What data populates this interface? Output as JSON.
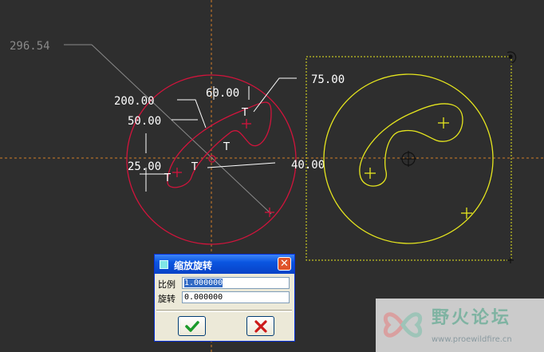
{
  "dimensions": {
    "d1": "296.54",
    "d2": "75.00",
    "d3": "200.00",
    "d4": "60.00",
    "d5": "50.00",
    "d6": "25.00",
    "d7": "40.00"
  },
  "tangent_mark": "T",
  "colors": {
    "background": "#2e2e2e",
    "sketch_red": "#d2143c",
    "sketch_yellow": "#e6e61e",
    "centerline": "#d27d28",
    "dimension_text": "#ffffff"
  },
  "dialog": {
    "title": "缩放旋转",
    "close_label": "✕",
    "scale_label": "比例",
    "scale_value": "1.000000",
    "rotate_label": "旋转",
    "rotate_value": "0.000000",
    "ok_icon": "check-icon",
    "cancel_icon": "x-icon"
  },
  "watermark": {
    "title": "野火论坛",
    "url": "www.proewildfire.cn"
  }
}
